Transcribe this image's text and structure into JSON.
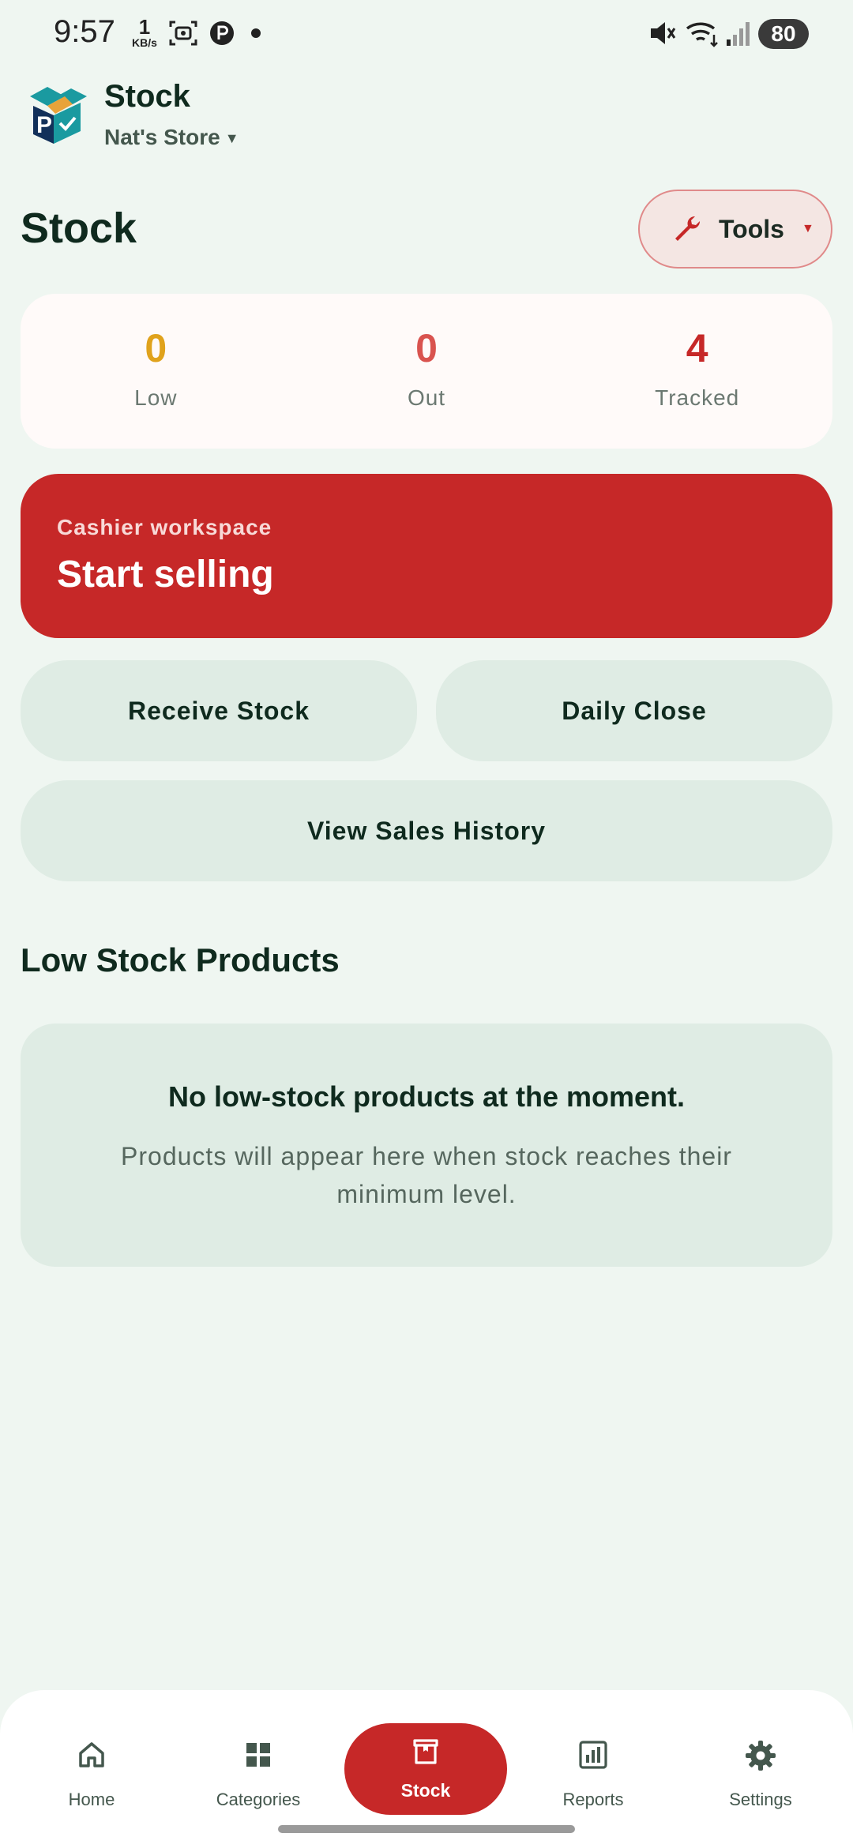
{
  "status_bar": {
    "time": "9:57",
    "net_speed_value": "1",
    "net_speed_unit": "KB/s",
    "battery": "80"
  },
  "header": {
    "app_title": "Stock",
    "store_name": "Nat's Store"
  },
  "page": {
    "title": "Stock",
    "tools_label": "Tools"
  },
  "stats": [
    {
      "value": "0",
      "label": "Low",
      "color": "#e0a21c"
    },
    {
      "value": "0",
      "label": "Out",
      "color": "#d9534f"
    },
    {
      "value": "4",
      "label": "Tracked",
      "color": "#c62828"
    }
  ],
  "start_card": {
    "subtitle": "Cashier workspace",
    "title": "Start selling"
  },
  "actions": {
    "receive_stock": "Receive Stock",
    "daily_close": "Daily Close",
    "view_sales_history": "View Sales History"
  },
  "low_stock": {
    "title": "Low Stock Products",
    "empty_title": "No low-stock products at the moment.",
    "empty_desc": "Products will appear here when stock reaches their minimum level."
  },
  "nav": [
    {
      "label": "Home",
      "icon": "home-icon"
    },
    {
      "label": "Categories",
      "icon": "grid-icon"
    },
    {
      "label": "Stock",
      "icon": "box-icon",
      "active": true
    },
    {
      "label": "Reports",
      "icon": "bar-chart-icon"
    },
    {
      "label": "Settings",
      "icon": "gear-icon"
    }
  ],
  "colors": {
    "accent": "#c62828",
    "background": "#eff6f1",
    "surface": "#dfece4"
  }
}
